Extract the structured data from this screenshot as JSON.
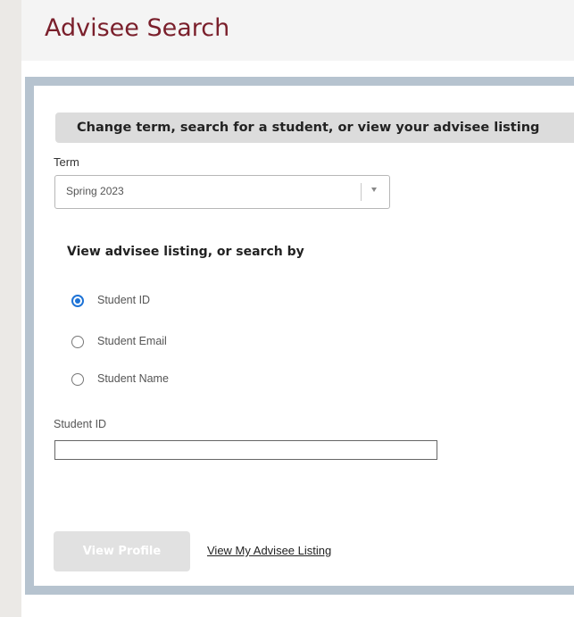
{
  "header": {
    "title": "Advisee Search"
  },
  "panel": {
    "instructions": "Change term, search for a student, or view your advisee listing",
    "term": {
      "label": "Term",
      "selected": "Spring 2023"
    },
    "search_heading": "View advisee listing, or search by",
    "search_options": [
      {
        "label": "Student ID",
        "checked": true
      },
      {
        "label": "Student Email",
        "checked": false
      },
      {
        "label": "Student Name",
        "checked": false
      }
    ],
    "field_label": "Student ID",
    "field_value": "",
    "view_profile_label": "View Profile",
    "advisee_listing_label": "View My Advisee Listing"
  },
  "colors": {
    "brand_title": "#7a1f2b",
    "panel_border": "#b6c3cf",
    "radio_accent": "#1e73d6",
    "disabled_button": "#e1e1e1"
  }
}
